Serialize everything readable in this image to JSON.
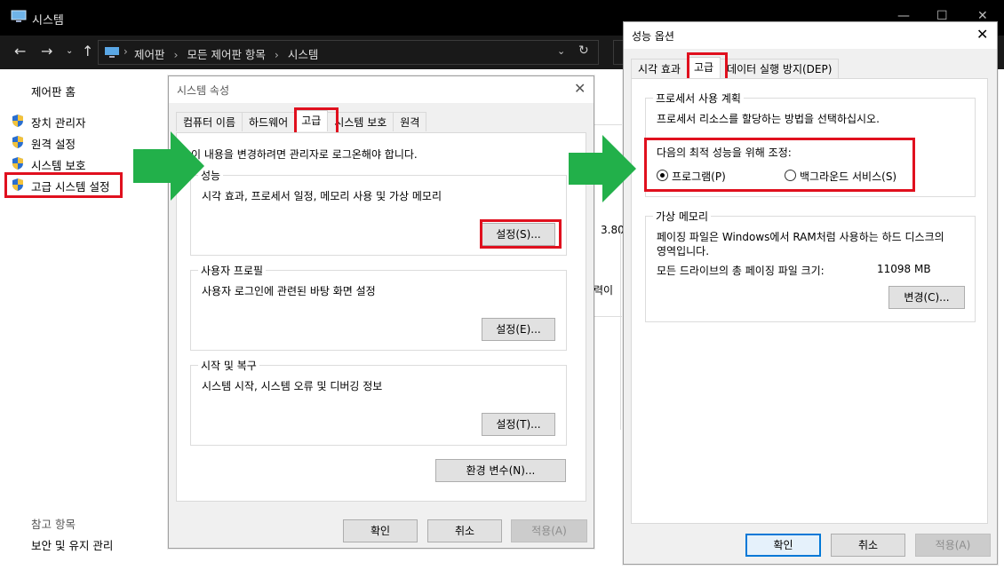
{
  "explorer": {
    "title": "시스템",
    "breadcrumbs": [
      "제어판",
      "모든 제어판 항목",
      "시스템"
    ],
    "sidebar": {
      "home": "제어판 홈",
      "items": [
        "장치 관리자",
        "원격 설정",
        "시스템 보호",
        "고급 시스템 설정"
      ],
      "see_also_heading": "참고 항목",
      "see_also": "보안 및 유지 관리"
    },
    "partial_right": {
      "value": "3.80",
      "text": "력이"
    }
  },
  "system_properties": {
    "title": "시스템 속성",
    "tabs": [
      "컴퓨터 이름",
      "하드웨어",
      "고급",
      "시스템 보호",
      "원격"
    ],
    "admin_note": "이 내용을 변경하려면 관리자로 로그온해야 합니다.",
    "performance": {
      "legend": "성능",
      "desc": "시각 효과, 프로세서 일정, 메모리 사용 및 가상 메모리",
      "button": "설정(S)..."
    },
    "user_profile": {
      "legend": "사용자 프로필",
      "desc": "사용자 로그인에 관련된 바탕 화면 설정",
      "button": "설정(E)..."
    },
    "startup": {
      "legend": "시작 및 복구",
      "desc": "시스템 시작, 시스템 오류 및 디버깅 정보",
      "button": "설정(T)..."
    },
    "env_button": "환경 변수(N)...",
    "ok": "확인",
    "cancel": "취소",
    "apply": "적용(A)"
  },
  "performance_options": {
    "title": "성능 옵션",
    "tabs": [
      "시각 효과",
      "고급",
      "데이터 실행 방지(DEP)"
    ],
    "processor": {
      "legend": "프로세서 사용 계획",
      "desc": "프로세서 리소스를 할당하는 방법을 선택하십시오.",
      "adjust_label": "다음의 최적 성능을 위해 조정:",
      "option_programs": "프로그램(P)",
      "option_services": "백그라운드 서비스(S)"
    },
    "virtual_memory": {
      "legend": "가상 메모리",
      "desc_line1": "페이징 파일은 Windows에서 RAM처럼 사용하는 하드 디스크의",
      "desc_line2": "영역입니다.",
      "total_label": "모든 드라이브의 총 페이징 파일 크기:",
      "total_value": "11098 MB",
      "change_button": "변경(C)..."
    },
    "ok": "확인",
    "cancel": "취소",
    "apply": "적용(A)"
  },
  "colors": {
    "highlight": "#e0101e",
    "arrow": "#22b04a",
    "focus": "#0078d7"
  }
}
